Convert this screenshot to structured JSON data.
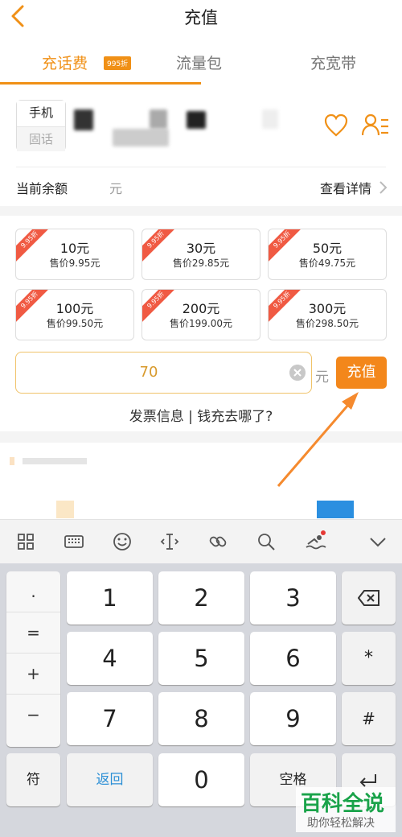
{
  "header": {
    "title": "充值"
  },
  "tabs": [
    {
      "label": "充话费",
      "badge": "995折",
      "active": true
    },
    {
      "label": "流量包",
      "active": false
    },
    {
      "label": "充宽带",
      "active": false
    }
  ],
  "phone": {
    "type_options": [
      "手机",
      "固话"
    ],
    "selected_type": "手机"
  },
  "balance": {
    "label": "当前余额",
    "unit": "元",
    "details_link": "查看详情"
  },
  "packages": [
    {
      "tag": "9.95折",
      "face": "10元",
      "price": "售价9.95元"
    },
    {
      "tag": "9.95折",
      "face": "30元",
      "price": "售价29.85元"
    },
    {
      "tag": "9.95折",
      "face": "50元",
      "price": "售价49.75元"
    },
    {
      "tag": "9.95折",
      "face": "100元",
      "price": "售价99.50元"
    },
    {
      "tag": "9.95折",
      "face": "200元",
      "price": "售价199.00元"
    },
    {
      "tag": "9.95折",
      "face": "300元",
      "price": "售价298.50元"
    }
  ],
  "custom_amount": {
    "value": "70",
    "unit": "元",
    "button": "充值"
  },
  "links": {
    "invoice": "发票信息",
    "separator": "|",
    "where": "钱充去哪了?"
  },
  "keyboard": {
    "symbols": [
      ".",
      "=",
      "+",
      "−"
    ],
    "numbers": [
      "1",
      "2",
      "3",
      "4",
      "5",
      "6",
      "7",
      "8",
      "9",
      "0"
    ],
    "symbol_key": "符",
    "back_key": "返回",
    "space_key": "空格",
    "star_key": "*",
    "hash_key": "#",
    "toolbar_icons": [
      "grid-icon",
      "keyboard-icon",
      "emoji-icon",
      "cursor-icon",
      "link-icon",
      "search-icon",
      "swim-icon",
      "collapse-icon"
    ]
  },
  "watermark": {
    "main": "百科全说",
    "sub": "助你轻松解决"
  },
  "colors": {
    "accent": "#f09016",
    "button": "#f3871b",
    "tag": "#f05a43",
    "watermark": "#1aa34a"
  }
}
